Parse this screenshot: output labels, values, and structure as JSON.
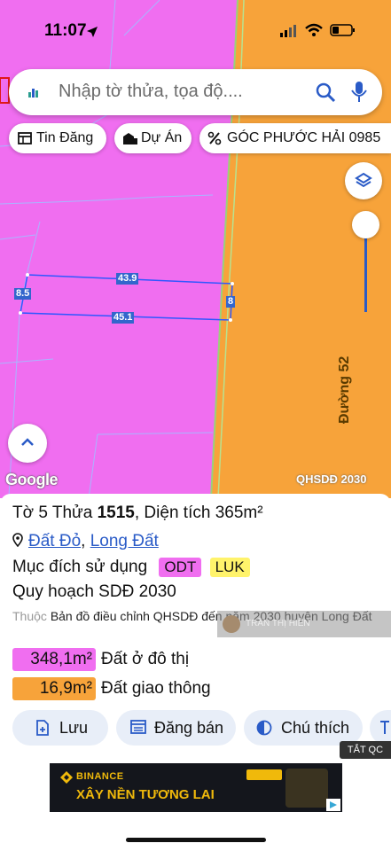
{
  "status_bar": {
    "time": "11:07"
  },
  "search": {
    "placeholder": "Nhập tờ thửa, tọa độ...."
  },
  "chips": [
    {
      "label": "Tin Đăng"
    },
    {
      "label": "Dự Án"
    },
    {
      "label": "GÓC PHƯỚC HẢI 0985"
    }
  ],
  "map": {
    "dimensions": {
      "top": "43.9",
      "bottom": "45.1",
      "left": "8.5",
      "right": "8"
    },
    "road_label": "Đường 52",
    "google_logo": "Google",
    "layer_label": "QHSDĐ 2030",
    "colors": {
      "residential": "#f06ef0",
      "transport": "#f7a33a"
    }
  },
  "parcel": {
    "title_prefix": "Tờ 5 Thửa ",
    "parcel_no": "1515",
    "area_text": ", Diện tích 365m²",
    "location": {
      "commune": "Đất Đỏ",
      "district": "Long Đất"
    },
    "purpose_label": "Mục đích sử dụng",
    "purpose_tags": [
      "ODT",
      "LUK"
    ],
    "plan_label": "Quy hoạch SDĐ 2030",
    "source_prefix": "Thuộc",
    "source_text": "Bản đồ điều chỉnh QHSDĐ đến năm 2030 huyện Long Đất",
    "areas": [
      {
        "value": "348,1m²",
        "label": "Đất ở đô thị",
        "color": "#f06ef0"
      },
      {
        "value": "16,9m²",
        "label": "Đất giao thông",
        "color": "#f7a33a"
      }
    ]
  },
  "actions": [
    {
      "label": "Lưu"
    },
    {
      "label": "Đăng bán"
    },
    {
      "label": "Chú thích"
    }
  ],
  "watermark": "TRẦN THỊ HIỀN",
  "ad": {
    "close_label": "TẮT QC",
    "brand": "BINANCE",
    "headline": "XÂY NỀN TƯƠNG LAI"
  }
}
